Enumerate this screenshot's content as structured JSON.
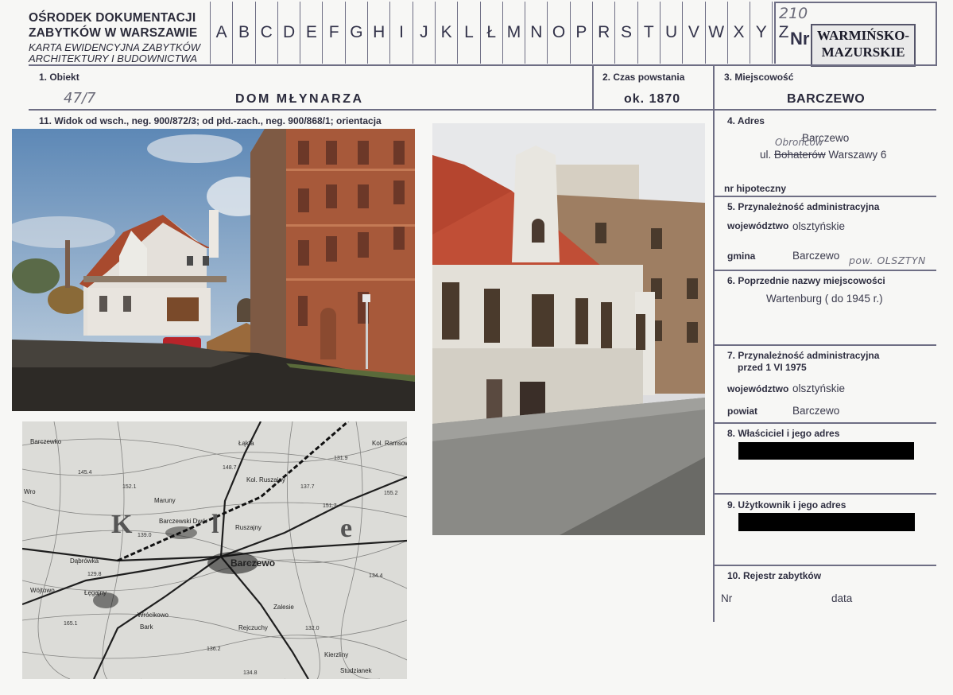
{
  "header": {
    "org_line1": "OŚRODEK DOKUMENTACJI",
    "org_line2": "ZABYTKÓW W WARSZAWIE",
    "org_line3": "KARTA EWIDENCYJNA ZABYTKÓW",
    "org_line4": "ARCHITEKTURY I BUDOWNICTWA",
    "letters": [
      "A",
      "B",
      "C",
      "D",
      "E",
      "F",
      "G",
      "H",
      "I",
      "J",
      "K",
      "L",
      "Ł",
      "M",
      "N",
      "O",
      "P",
      "R",
      "S",
      "T",
      "U",
      "V",
      "W",
      "X",
      "Y",
      "Z"
    ],
    "nr_label": "Nr",
    "nr_handwritten": "210",
    "stamp_line1": "WARMIŃSKO-",
    "stamp_line2": "MAZURSKIE"
  },
  "fields": {
    "obiekt_label": "1. Obiekt",
    "obiekt_hand": "47/7",
    "obiekt_value": "DOM MŁYNARZA",
    "czas_label": "2. Czas powstania",
    "czas_value": "ok. 1870",
    "miejscowosc_label": "3. Miejscowość",
    "miejscowosc_value": "BARCZEWO",
    "widok_label": "11. Widok od wsch., neg. 900/872/3; od płd.-zach., neg. 900/868/1; orientacja",
    "adres_label": "4. Adres",
    "adres_line1": "Barczewo",
    "adres_prefix": "ul.",
    "adres_struck": "Bohaterów",
    "adres_hand": "Obrońców",
    "adres_suffix": "Warszawy 6",
    "hipoteczny_label": "nr hipoteczny",
    "przynaleznosc_label": "5. Przynależność administracyjna",
    "woj_label": "województwo",
    "woj_value": "olsztyńskie",
    "gmina_label": "gmina",
    "gmina_value": "Barczewo",
    "gmina_hand": "pow. OLSZTYN",
    "poprzednie_label": "6. Poprzednie nazwy miejscowości",
    "poprzednie_value": "Wartenburg ( do 1945 r.)",
    "przyn1975_label1": "7. Przynależność administracyjna",
    "przyn1975_label2": "przed 1 VI 1975",
    "woj2_label": "województwo",
    "woj2_value": "olsztyńskie",
    "powiat_label": "powiat",
    "powiat_value": "Barczewo",
    "wlasciciel_label": "8. Właściciel i jego adres",
    "uzytkownik_label": "9. Użytkownik i jego adres",
    "rejestr_label": "10. Rejestr zabytków",
    "nr_label": "Nr",
    "data_label": "data"
  },
  "map": {
    "letters": [
      "K",
      "l",
      "e"
    ],
    "labels": [
      "Barczewo",
      "Łęgajny",
      "Wrócikowo",
      "Kol. Ruszajny",
      "Ruszajny",
      "Maruny",
      "Barczewski Dwór",
      "Kierzliny",
      "Studzianek",
      "Rejczuchy",
      "Bark",
      "Zalesie",
      "Łąkta",
      "Dąbrówka",
      "Wójtowo",
      "Kol. Ramsowo",
      "Barczewko",
      "Wro"
    ],
    "numbers": [
      "145.4",
      "152.1",
      "131.9",
      "148.7",
      "139.0",
      "137.7",
      "134.4",
      "129.8",
      "165.1",
      "132.0",
      "136.2",
      "134.8",
      "155.2",
      "151.7"
    ]
  },
  "colors": {
    "ink": "#2a2a38",
    "rule": "#6e6e84",
    "paper": "#f7f7f5",
    "brick": "#b2633e",
    "roof": "#c45a3c",
    "sky": "#7ea3c8"
  }
}
